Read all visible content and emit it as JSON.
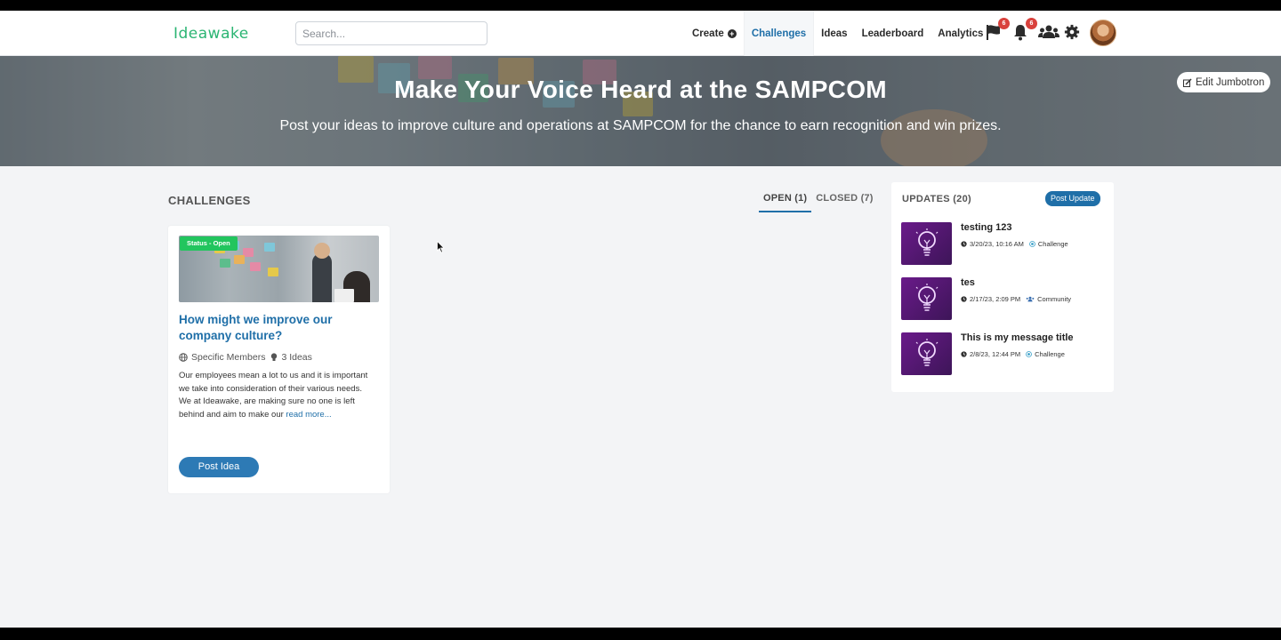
{
  "header": {
    "logo_text": "Ideawake",
    "search_placeholder": "Search...",
    "nav": {
      "create": "Create",
      "challenges": "Challenges",
      "ideas": "Ideas",
      "leaderboard": "Leaderboard",
      "analytics": "Analytics"
    },
    "flag_badge": "6",
    "bell_badge": "6"
  },
  "jumbotron": {
    "title": "Make Your Voice Heard at the SAMPCOM",
    "subtitle": "Post your ideas to improve culture and operations at SAMPCOM for the chance to earn recognition and win prizes.",
    "edit_label": "Edit Jumbotron"
  },
  "main": {
    "heading": "CHALLENGES",
    "tabs": [
      {
        "label": "OPEN (1)"
      },
      {
        "label": "CLOSED (7)"
      }
    ],
    "card": {
      "status": "Status - Open",
      "title": "How might we improve our company culture?",
      "visibility": "Specific Members",
      "ideas_count": "3 Ideas",
      "description": "Our employees mean a lot to us and it is important we take into consideration of their various needs. We at Ideawake, are making sure no one is left behind and aim to make our",
      "read_more": "read more...",
      "button": "Post Idea"
    }
  },
  "updates": {
    "title": "UPDATES (20)",
    "post_button": "Post Update",
    "items": [
      {
        "title": "testing 123",
        "date": "3/20/23, 10:16 AM",
        "type": "Challenge"
      },
      {
        "title": "tes",
        "date": "2/17/23, 2:09 PM",
        "type": "Community"
      },
      {
        "title": "This is my message title",
        "date": "2/8/23, 12:44 PM",
        "type": "Challenge"
      }
    ]
  },
  "colors": {
    "brand_green": "#2bb573",
    "link_blue": "#1f6fa8",
    "status_green": "#22c55e",
    "badge_red": "#d9413c",
    "update_thumb": "#5a1a7a"
  }
}
